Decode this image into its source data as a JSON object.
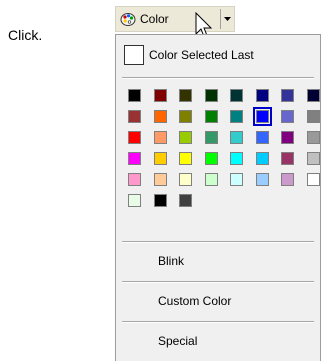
{
  "instruction": "Click.",
  "toolbar": {
    "button_label": "Color",
    "icon": "palette-icon",
    "dropdown_icon": "dropdown-arrow-icon"
  },
  "menu": {
    "last_selected_label": "Color Selected Last",
    "last_selected_color": "#ffffff",
    "selected_color": "#0000ff",
    "palette": [
      [
        "#000000",
        "#800000",
        "#333300",
        "#003300",
        "#003333",
        "#000080",
        "#333399",
        "#000033"
      ],
      [
        "#993333",
        "#ff6600",
        "#808000",
        "#008000",
        "#008080",
        "#0000ff",
        "#6666cc",
        "#808080"
      ],
      [
        "#ff0000",
        "#ff9966",
        "#99cc00",
        "#339966",
        "#33cccc",
        "#3366ff",
        "#800080",
        "#999999"
      ],
      [
        "#ff00ff",
        "#ffcc00",
        "#ffff00",
        "#00ff00",
        "#00ffff",
        "#00ccff",
        "#993366",
        "#c0c0c0"
      ],
      [
        "#ff99cc",
        "#ffcc99",
        "#ffffcc",
        "#ccffcc",
        "#ccffff",
        "#99ccff",
        "#cc99cc",
        "#ffffff"
      ],
      [
        "#e8fce8",
        "#000000",
        "#404040"
      ]
    ],
    "items": [
      "Blink",
      "Custom Color",
      "Special"
    ]
  }
}
